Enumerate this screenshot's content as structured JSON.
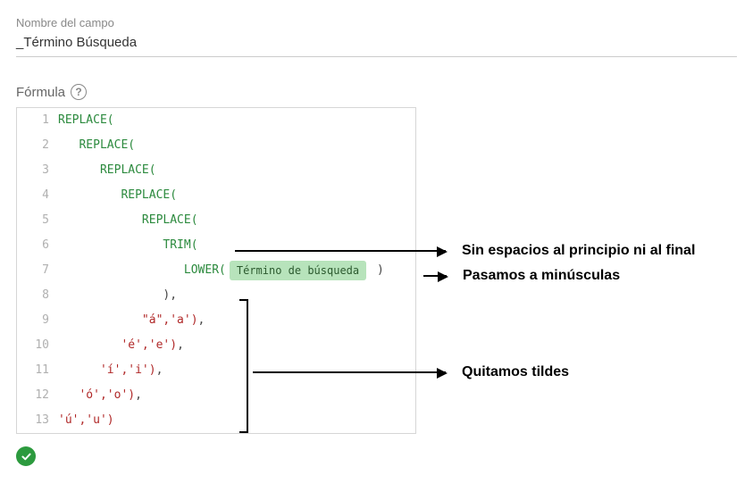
{
  "field": {
    "label": "Nombre del campo",
    "value": "_Término Búsqueda"
  },
  "formula": {
    "label": "Fórmula",
    "help_tooltip": "?",
    "pill_label": "Término de búsqueda",
    "lines": {
      "l1": "REPLACE(",
      "l2_indent": "   ",
      "l2": "REPLACE(",
      "l3_indent": "      ",
      "l3": "REPLACE(",
      "l4_indent": "         ",
      "l4": "REPLACE(",
      "l5_indent": "            ",
      "l5": "REPLACE(",
      "l6_indent": "               ",
      "l6": "TRIM(",
      "l7_indent": "                  ",
      "l7": "LOWER(",
      "l7_close": " )",
      "l8_indent": "               ",
      "l8": "),",
      "l9_indent": "            ",
      "l9": "\"á\",'a')",
      "l9_comma": ",",
      "l10_indent": "         ",
      "l10": "'é','e')",
      "l10_comma": ",",
      "l11_indent": "      ",
      "l11": "'í','i')",
      "l11_comma": ",",
      "l12_indent": "   ",
      "l12": "'ó','o')",
      "l12_comma": ",",
      "l13": "'ú','u')"
    }
  },
  "annotations": {
    "a1": "Sin espacios al principio ni al final",
    "a2": "Pasamos a minúsculas",
    "a3": "Quitamos tildes"
  },
  "line_numbers": [
    "1",
    "2",
    "3",
    "4",
    "5",
    "6",
    "7",
    "8",
    "9",
    "10",
    "11",
    "12",
    "13"
  ]
}
